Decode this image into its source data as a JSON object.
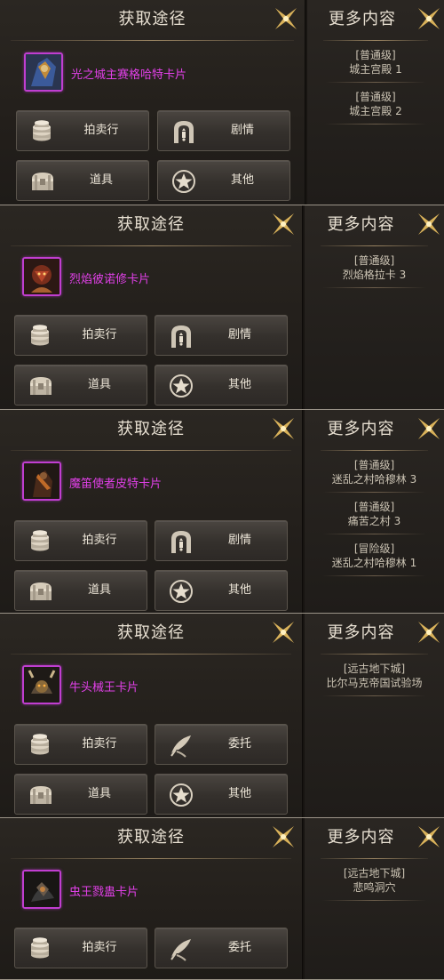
{
  "panels": [
    {
      "left_title": "获取途径",
      "right_title": "更多内容",
      "card_name": "光之城主赛格哈特卡片",
      "buttons": [
        "拍卖行",
        "剧情",
        "道具",
        "其他"
      ],
      "button_icons": [
        "coin-stack-icon",
        "gate-icon",
        "chest-icon",
        "star-icon"
      ],
      "sources": [
        {
          "tag": "[普通级]",
          "place": "城主宫殿 1"
        },
        {
          "tag": "[普通级]",
          "place": "城主宫殿 2"
        }
      ]
    },
    {
      "left_title": "获取途径",
      "right_title": "更多内容",
      "card_name": "烈焰彼诺修卡片",
      "buttons": [
        "拍卖行",
        "剧情",
        "道具",
        "其他"
      ],
      "button_icons": [
        "coin-stack-icon",
        "gate-icon",
        "chest-icon",
        "star-icon"
      ],
      "sources": [
        {
          "tag": "[普通级]",
          "place": "烈焰格拉卡 3"
        }
      ]
    },
    {
      "left_title": "获取途径",
      "right_title": "更多内容",
      "card_name": "魔笛使者皮特卡片",
      "buttons": [
        "拍卖行",
        "剧情",
        "道具",
        "其他"
      ],
      "button_icons": [
        "coin-stack-icon",
        "gate-icon",
        "chest-icon",
        "star-icon"
      ],
      "sources": [
        {
          "tag": "[普通级]",
          "place": "迷乱之村哈穆林 3"
        },
        {
          "tag": "[普通级]",
          "place": "痛苦之村 3"
        },
        {
          "tag": "[冒险级]",
          "place": "迷乱之村哈穆林 1"
        }
      ]
    },
    {
      "left_title": "获取途径",
      "right_title": "更多内容",
      "card_name": "牛头械王卡片",
      "buttons": [
        "拍卖行",
        "委托",
        "道具",
        "其他"
      ],
      "button_icons": [
        "coin-stack-icon",
        "quill-icon",
        "chest-icon",
        "star-icon"
      ],
      "sources": [
        {
          "tag": "[远古地下城]",
          "place": "比尔马克帝国试验场"
        }
      ]
    },
    {
      "left_title": "获取途径",
      "right_title": "更多内容",
      "card_name": "虫王戮蛊卡片",
      "buttons": [
        "拍卖行",
        "委托"
      ],
      "button_icons": [
        "coin-stack-icon",
        "quill-icon"
      ],
      "sources": [
        {
          "tag": "[远古地下城]",
          "place": "悲鸣洞穴"
        }
      ]
    }
  ],
  "colors": {
    "card_name": "#e140e8",
    "card_border": "#c03ed0",
    "close_gold": "#d9b25a"
  }
}
